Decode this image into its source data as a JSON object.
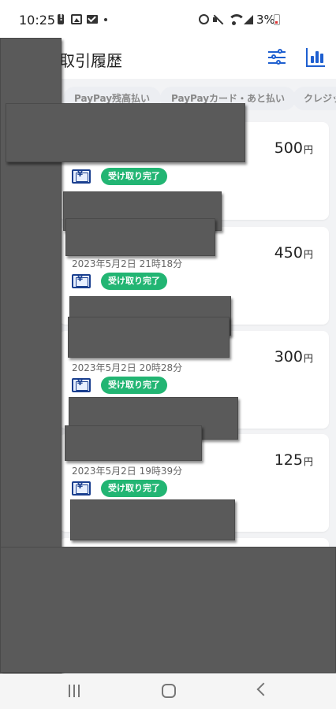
{
  "status_bar": {
    "time": "10:25",
    "battery_text": "3%"
  },
  "header": {
    "title": "取引履歴"
  },
  "chips": [
    {
      "label": "PayPay残高払い"
    },
    {
      "label": "PayPayカード・あと払い"
    },
    {
      "label": "クレジット"
    }
  ],
  "transactions": [
    {
      "amount": "500",
      "unit": "円",
      "date": "",
      "status": "受け取り完了"
    },
    {
      "amount": "450",
      "unit": "円",
      "date": "2023年5月2日 21時18分",
      "status": "受け取り完了"
    },
    {
      "amount": "300",
      "unit": "円",
      "date": "2023年5月2日 20時28分",
      "status": "受け取り完了"
    },
    {
      "amount": "125",
      "unit": "円",
      "date": "2023年5月2日 19時39分",
      "status": "受け取り完了"
    }
  ],
  "icons": {
    "filter": "sliders-icon",
    "chart": "bar-chart-icon",
    "bill": "yen-bill-icon",
    "nav_recent": "recent-apps-icon",
    "nav_home": "home-icon",
    "nav_back": "back-icon"
  },
  "colors": {
    "accent": "#1e5fd0",
    "status_green": "#22b573",
    "redaction": "#5a5a5a"
  }
}
